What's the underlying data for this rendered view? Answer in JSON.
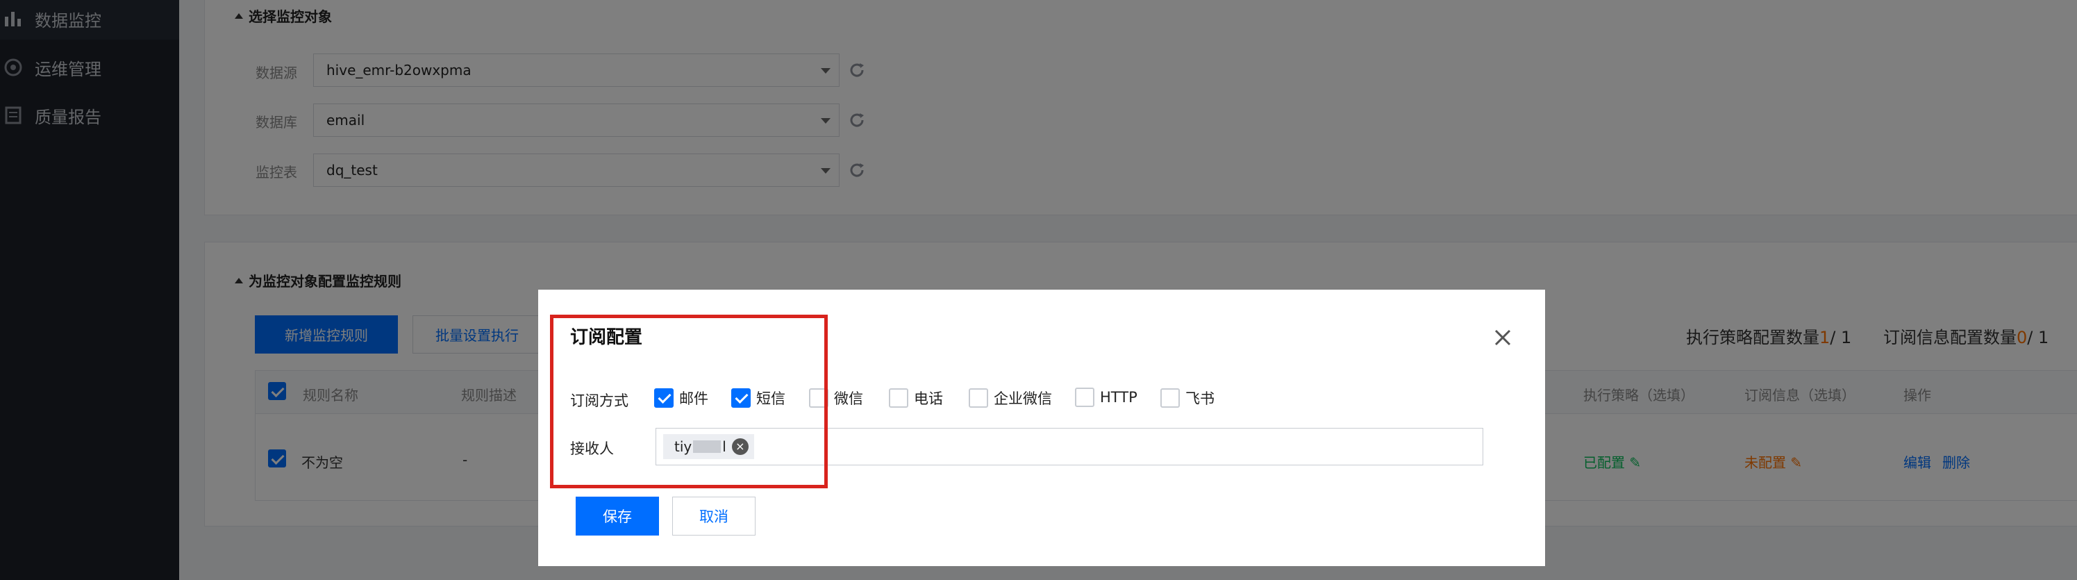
{
  "sidebar": {
    "items": [
      {
        "label": "数据监控",
        "icon": "bar-chart-icon",
        "active": true
      },
      {
        "label": "运维管理",
        "icon": "ops-gear-icon"
      },
      {
        "label": "质量报告",
        "icon": "report-icon"
      }
    ]
  },
  "section1": {
    "title": "选择监控对象",
    "fields": [
      {
        "label": "数据源",
        "value": "hive_emr-b2owxpma"
      },
      {
        "label": "数据库",
        "value": "email"
      },
      {
        "label": "监控表",
        "value": "dq_test"
      }
    ]
  },
  "section2": {
    "title": "为监控对象配置监控规则",
    "add_rule_label": "新增监控规则",
    "batch_label": "批量设置执行",
    "counter_exec_label": "执行策略配置数量",
    "counter_exec_current": "1",
    "counter_exec_total": "/ 1",
    "counter_sub_label": "订阅信息配置数量",
    "counter_sub_current": "0",
    "counter_sub_total": "/ 1",
    "columns": {
      "name": "规则名称",
      "desc": "规则描述",
      "exec": "执行策略（选填）",
      "sub": "订阅信息（选填）",
      "ops": "操作"
    },
    "row": {
      "name": "不为空",
      "desc": "-",
      "exec": "已配置",
      "sub": "未配置",
      "edit": "编辑",
      "delete": "删除"
    }
  },
  "modal": {
    "title": "订阅配置",
    "sub_label": "订阅方式",
    "options": [
      {
        "label": "邮件",
        "checked": true
      },
      {
        "label": "短信",
        "checked": true
      },
      {
        "label": "微信",
        "checked": false
      },
      {
        "label": "电话",
        "checked": false
      },
      {
        "label": "企业微信",
        "checked": false
      },
      {
        "label": "HTTP",
        "checked": false
      },
      {
        "label": "飞书",
        "checked": false
      }
    ],
    "recipient_label": "接收人",
    "recipient_tag_prefix": "tiy",
    "recipient_tag_suffix": "l",
    "save_label": "保存",
    "cancel_label": "取消"
  },
  "colors": {
    "primary": "#006eff",
    "highlight": "#d8231d",
    "success": "#0abf5b",
    "warning": "#ff7200"
  }
}
